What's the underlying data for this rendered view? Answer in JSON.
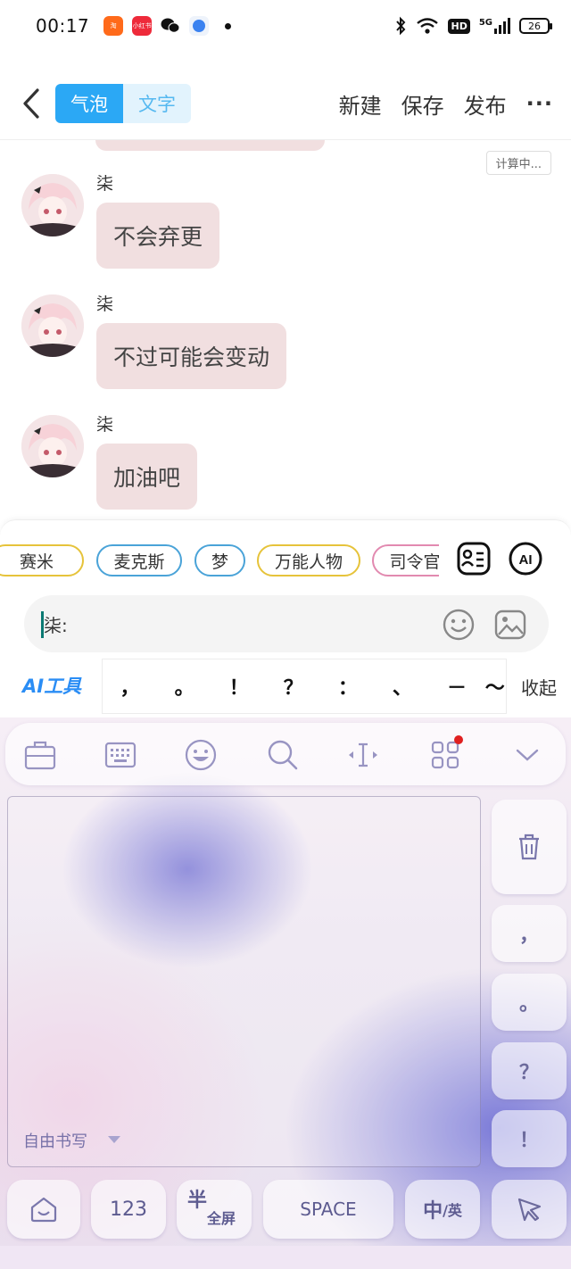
{
  "status_bar": {
    "time": "00:17",
    "hd": "HD",
    "network": "5G",
    "battery": "26",
    "app_icons": [
      "taobao-icon",
      "xiaohongshu-icon",
      "wechat-icon",
      "blue-app-icon"
    ]
  },
  "nav": {
    "tab_bubble": "气泡",
    "tab_text": "文字",
    "new": "新建",
    "save": "保存",
    "publish": "发布",
    "more": "···"
  },
  "chat": {
    "calc_badge": "计算中...",
    "messages": [
      {
        "name": "柒",
        "text": "不会弃更"
      },
      {
        "name": "柒",
        "text": "不过可能会变动"
      },
      {
        "name": "柒",
        "text": "加油吧"
      }
    ]
  },
  "panel": {
    "chips": [
      "赛米",
      "麦克斯",
      "梦",
      "万能人物",
      "司令官"
    ],
    "input_value": "柒:",
    "ai_tool": "AI工具",
    "punctuation": [
      "，",
      "。",
      "！",
      "？",
      "：",
      "、",
      "－",
      "～"
    ],
    "collapse": "收起"
  },
  "keyboard": {
    "handwriting_mode": "自由书写",
    "side_keys": [
      "，",
      "。",
      "？",
      "！"
    ],
    "num_key": "123",
    "half_label": "半",
    "full_label": "全屏",
    "space_key": "SPACE",
    "lang_main": "中",
    "lang_sub": "/英"
  },
  "colors": {
    "accent_blue": "#2ba8f5",
    "bubble_pink": "#f1dfe0",
    "keyboard_purple": "#7b7bd6",
    "notification_red": "#e02020"
  }
}
